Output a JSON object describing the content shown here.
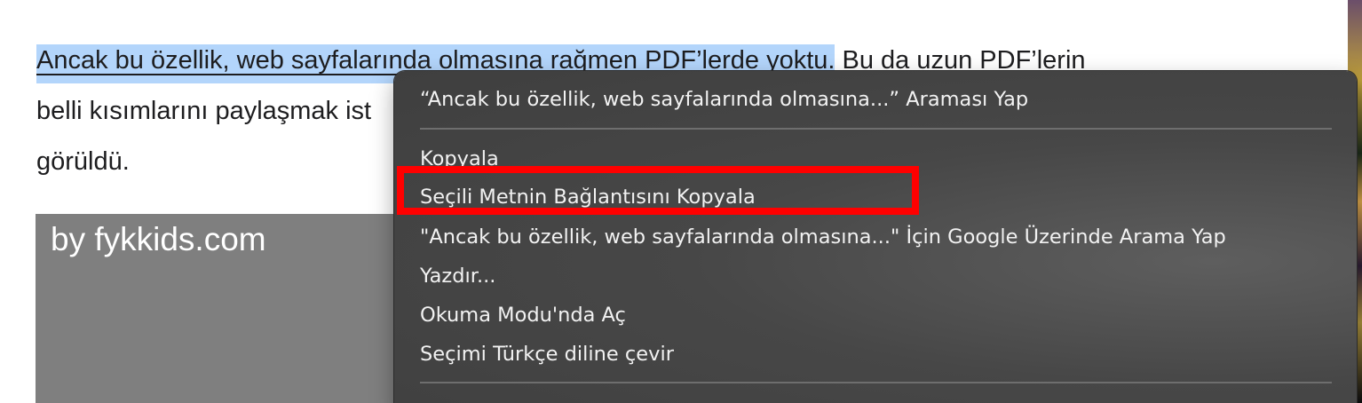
{
  "article": {
    "line1_selected": "Ancak bu özellik, web sayfalarında olmasına rağmen PDF’lerde yoktu.",
    "line1_rest": " Bu da uzun PDF’lerin",
    "line2": "belli kısımlarını paylaşmak ist",
    "line3": "görüldü."
  },
  "image": {
    "caption": "by fykkids.com"
  },
  "context_menu": {
    "search_item": "“Ancak bu özellik, web sayfalarında olmasına...” Araması Yap",
    "copy": "Kopyala",
    "copy_link_to_highlight": "Seçili Metnin Bağlantısını Kopyala",
    "google_search": "\"Ancak bu özellik, web sayfalarında olmasına...\" İçin Google Üzerinde Arama Yap",
    "print": "Yazdır...",
    "reader_mode": "Okuma Modu'nda Aç",
    "translate": "Seçimi Türkçe diline çevir"
  },
  "colors": {
    "selection": "#b3d5fb",
    "menu_background": "#454545",
    "highlight_box": "#ff0000",
    "image_background": "#7f7f7f"
  }
}
